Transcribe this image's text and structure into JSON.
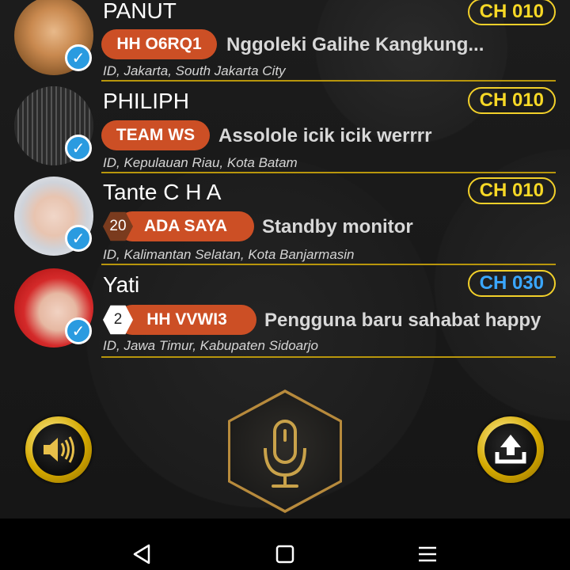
{
  "contacts": [
    {
      "name": "PANUT",
      "channel": "CH 010",
      "channel_color": "#f7d826",
      "tag": "HH O6RQ1",
      "level": "",
      "status": "Nggoleki Galihe Kangkung...",
      "location": "ID, Jakarta, South Jakarta City",
      "avatar": "monkey-king-avatar",
      "verified": true
    },
    {
      "name": "PHILIPH",
      "channel": "CH 010",
      "channel_color": "#f7d826",
      "tag": "TEAM WS",
      "level": "",
      "status": "Assolole icik icik werrrr",
      "location": "ID, Kepulauan Riau, Kota Batam",
      "avatar": "mixer-console-avatar",
      "verified": true
    },
    {
      "name": "Tante C H A",
      "channel": "CH 010",
      "channel_color": "#f7d826",
      "tag": "ADA SAYA",
      "level": "20",
      "status": "Standby monitor",
      "location": "ID, Kalimantan Selatan, Kota Banjarmasin",
      "avatar": "woman-hijab-avatar",
      "verified": true
    },
    {
      "name": "Yati",
      "channel": "CH 030",
      "channel_color": "#3aa7ff",
      "tag": "HH VVWI3",
      "level": "2",
      "status": "Pengguna baru sahabat happy",
      "location": "ID, Jawa Timur, Kabupaten Sidoarjo",
      "avatar": "woman-red-hijab-avatar",
      "verified": true
    }
  ],
  "controls": {
    "speaker_icon": "speaker-icon",
    "mic_icon": "microphone-icon",
    "upload_icon": "upload-icon"
  },
  "navbar": {
    "back_icon": "back-triangle-icon",
    "home_icon": "home-square-icon",
    "menu_icon": "menu-lines-icon"
  },
  "colors": {
    "accent_gold": "#b8960c",
    "tag_bg": "#cc4f25",
    "verify_blue": "#2a9be0"
  }
}
